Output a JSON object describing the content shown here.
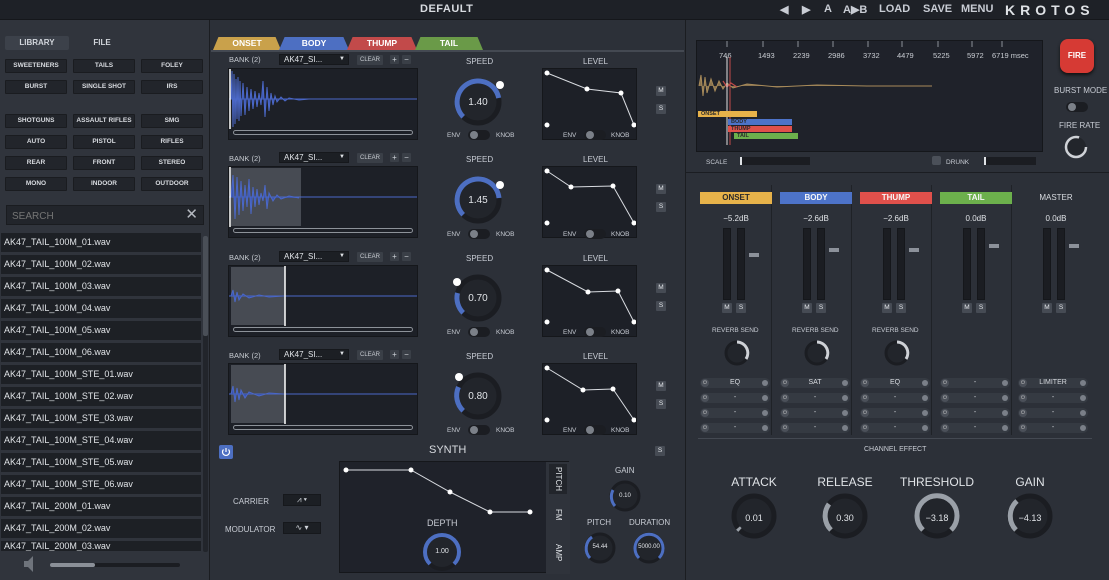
{
  "titlebar": {
    "preset_name": "DEFAULT",
    "prev": "◀",
    "next": "▶",
    "a": "A",
    "ab": "A▶B",
    "load": "LOAD",
    "save": "SAVE",
    "menu": "MENU",
    "logo": "KROTOS"
  },
  "library": {
    "tabs": [
      "LIBRARY",
      "FILE"
    ],
    "categories_top": [
      "SWEETENERS",
      "TAILS",
      "FOLEY",
      "BURST",
      "SINGLE SHOT",
      "IRS"
    ],
    "categories_bottom": [
      "SHOTGUNS",
      "ASSAULT RIFLES",
      "SMG",
      "AUTO",
      "PISTOL",
      "RIFLES",
      "REAR",
      "FRONT",
      "STEREO",
      "MONO",
      "INDOOR",
      "OUTDOOR"
    ],
    "search_placeholder": "SEARCH",
    "files": [
      "AK47_TAIL_100M_01.wav",
      "AK47_TAIL_100M_02.wav",
      "AK47_TAIL_100M_03.wav",
      "AK47_TAIL_100M_04.wav",
      "AK47_TAIL_100M_05.wav",
      "AK47_TAIL_100M_06.wav",
      "AK47_TAIL_100M_STE_01.wav",
      "AK47_TAIL_100M_STE_02.wav",
      "AK47_TAIL_100M_STE_03.wav",
      "AK47_TAIL_100M_STE_04.wav",
      "AK47_TAIL_100M_STE_05.wav",
      "AK47_TAIL_100M_STE_06.wav",
      "AK47_TAIL_200M_01.wav",
      "AK47_TAIL_200M_02.wav",
      "AK47_TAIL_200M_03.wav"
    ]
  },
  "layers": {
    "tabs": [
      "ONSET",
      "BODY",
      "THUMP",
      "TAIL"
    ],
    "tab_colors": [
      "#c9a14b",
      "#4d6fc2",
      "#c24a4a",
      "#6a9a48"
    ],
    "rows": [
      {
        "bank": "BANK (2)",
        "file": "AK47_SI...",
        "speed": "1.40",
        "speed_level": 0.62
      },
      {
        "bank": "BANK (2)",
        "file": "AK47_SI...",
        "speed": "1.45",
        "speed_level": 0.65
      },
      {
        "bank": "BANK (2)",
        "file": "AK47_SI...",
        "speed": "0.70",
        "speed_level": 0.2
      },
      {
        "bank": "BANK (2)",
        "file": "AK47_SI...",
        "speed": "0.80",
        "speed_level": 0.25
      }
    ],
    "clear": "CLEAR",
    "plus": "+",
    "minus": "−",
    "speed_label": "SPEED",
    "level_label": "LEVEL",
    "env": "ENV",
    "knob": "KNOB",
    "mute": "M",
    "solo": "S"
  },
  "synth": {
    "title": "SYNTH",
    "solo": "S",
    "carrier_label": "CARRIER",
    "modulator_label": "MODULATOR",
    "side_tabs": [
      "PITCH",
      "FM",
      "AMP"
    ],
    "depth_label": "DEPTH",
    "depth_value": "1.00",
    "gain_label": "GAIN",
    "gain_value": "0.10",
    "pitch_label": "PITCH",
    "pitch_value": "54.44",
    "duration_label": "DURATION",
    "duration_value": "5000.00"
  },
  "timeline": {
    "ticks": [
      "746",
      "1493",
      "2239",
      "2986",
      "3732",
      "4479",
      "5225",
      "5972",
      "6719 msec"
    ],
    "bars": [
      "ONSET",
      "BODY",
      "THUMP",
      "TAIL"
    ],
    "scale_label": "SCALE",
    "drunk_label": "DRUNK"
  },
  "fire": {
    "label": "FIRE",
    "burst_mode": "BURST MODE",
    "fire_rate": "FIRE RATE"
  },
  "mixer": {
    "channels": [
      {
        "name": "ONSET",
        "color": "#e7b24a",
        "db": "−5.2dB",
        "reverb": "REVERB SEND",
        "fx": "EQ"
      },
      {
        "name": "BODY",
        "color": "#4d73c9",
        "db": "−2.6dB",
        "reverb": "REVERB SEND",
        "fx": "SAT"
      },
      {
        "name": "THUMP",
        "color": "#e0504b",
        "db": "−2.6dB",
        "reverb": "REVERB SEND",
        "fx": "EQ"
      },
      {
        "name": "TAIL",
        "color": "#6cb04c",
        "db": "0.0dB",
        "reverb": "",
        "fx": "-"
      },
      {
        "name": "MASTER",
        "color": "",
        "db": "0.0dB",
        "reverb": "",
        "fx": "LIMITER"
      }
    ],
    "empty_fx": "-",
    "channel_effect": "CHANNEL EFFECT",
    "attack_label": "ATTACK",
    "attack_value": "0.01",
    "release_label": "RELEASE",
    "release_value": "0.30",
    "threshold_label": "THRESHOLD",
    "threshold_value": "−3.18",
    "gain_label": "GAIN",
    "gain_value": "−4.13"
  }
}
